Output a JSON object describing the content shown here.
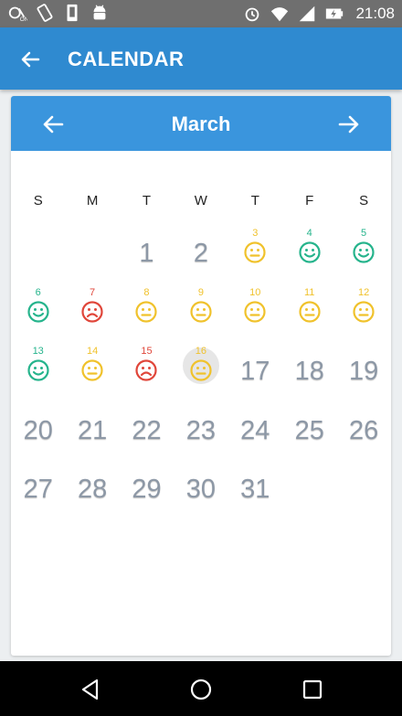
{
  "status_bar": {
    "time": "21:08",
    "left_icons": [
      "nfc-icon",
      "screen-rotate-icon",
      "sim-icon",
      "android-icon"
    ],
    "right_icons": [
      "alarm-icon",
      "wifi-icon",
      "signal-icon",
      "battery-charging-icon"
    ]
  },
  "app_bar": {
    "title": "CALENDAR",
    "back_icon": "arrow-left-icon"
  },
  "calendar": {
    "month": "March",
    "prev_icon": "arrow-left-icon",
    "next_icon": "arrow-right-icon",
    "weekdays": [
      "S",
      "M",
      "T",
      "W",
      "T",
      "F",
      "S"
    ],
    "mood_colors": {
      "happy": "#26b48c",
      "neutral": "#f0c22c",
      "sad": "#e0463a"
    },
    "today": 16,
    "days": [
      {
        "day": "1",
        "mood": null
      },
      {
        "day": "2",
        "mood": null
      },
      {
        "day": "3",
        "mood": "neutral"
      },
      {
        "day": "4",
        "mood": "happy"
      },
      {
        "day": "5",
        "mood": "happy"
      },
      {
        "day": "6",
        "mood": "happy"
      },
      {
        "day": "7",
        "mood": "sad"
      },
      {
        "day": "8",
        "mood": "neutral"
      },
      {
        "day": "9",
        "mood": "neutral"
      },
      {
        "day": "10",
        "mood": "neutral"
      },
      {
        "day": "11",
        "mood": "neutral"
      },
      {
        "day": "12",
        "mood": "neutral"
      },
      {
        "day": "13",
        "mood": "happy"
      },
      {
        "day": "14",
        "mood": "neutral"
      },
      {
        "day": "15",
        "mood": "sad"
      },
      {
        "day": "16",
        "mood": "neutral"
      },
      {
        "day": "17",
        "mood": null
      },
      {
        "day": "18",
        "mood": null
      },
      {
        "day": "19",
        "mood": null
      },
      {
        "day": "20",
        "mood": null
      },
      {
        "day": "21",
        "mood": null
      },
      {
        "day": "22",
        "mood": null
      },
      {
        "day": "23",
        "mood": null
      },
      {
        "day": "24",
        "mood": null
      },
      {
        "day": "25",
        "mood": null
      },
      {
        "day": "26",
        "mood": null
      },
      {
        "day": "27",
        "mood": null
      },
      {
        "day": "28",
        "mood": null
      },
      {
        "day": "29",
        "mood": null
      },
      {
        "day": "30",
        "mood": null
      },
      {
        "day": "31",
        "mood": null
      }
    ]
  },
  "nav_bar": {
    "icons": [
      "back-triangle-icon",
      "home-circle-icon",
      "recents-square-icon"
    ]
  }
}
